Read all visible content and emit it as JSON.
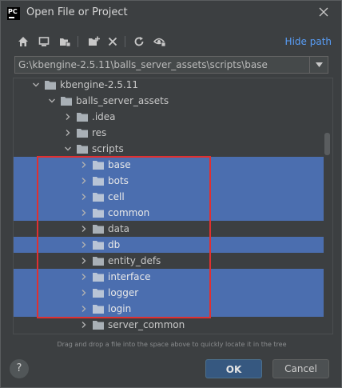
{
  "window": {
    "app_icon_text": "PC",
    "title": "Open File or Project",
    "close_icon": "close-icon"
  },
  "toolbar": {
    "buttons": [
      "home-icon",
      "desktop-icon",
      "project-folder-icon",
      "new-folder-icon",
      "delete-icon",
      "refresh-icon",
      "show-hidden-icon"
    ],
    "hide_path_label": "Hide path"
  },
  "path": {
    "value": "G:\\kbengine-2.5.11\\balls_server_assets\\scripts\\base"
  },
  "tree": {
    "items": [
      {
        "label": "kbengine-2.5.11",
        "depth": 1,
        "expanded": true,
        "selected": false
      },
      {
        "label": "balls_server_assets",
        "depth": 2,
        "expanded": true,
        "selected": false
      },
      {
        "label": ".idea",
        "depth": 3,
        "expanded": false,
        "selected": false
      },
      {
        "label": "res",
        "depth": 3,
        "expanded": false,
        "selected": false
      },
      {
        "label": "scripts",
        "depth": 3,
        "expanded": true,
        "selected": false
      },
      {
        "label": "base",
        "depth": 4,
        "expanded": false,
        "selected": true
      },
      {
        "label": "bots",
        "depth": 4,
        "expanded": false,
        "selected": true
      },
      {
        "label": "cell",
        "depth": 4,
        "expanded": false,
        "selected": true
      },
      {
        "label": "common",
        "depth": 4,
        "expanded": false,
        "selected": true
      },
      {
        "label": "data",
        "depth": 4,
        "expanded": false,
        "selected": false
      },
      {
        "label": "db",
        "depth": 4,
        "expanded": false,
        "selected": true
      },
      {
        "label": "entity_defs",
        "depth": 4,
        "expanded": false,
        "selected": false
      },
      {
        "label": "interface",
        "depth": 4,
        "expanded": false,
        "selected": true
      },
      {
        "label": "logger",
        "depth": 4,
        "expanded": false,
        "selected": true
      },
      {
        "label": "login",
        "depth": 4,
        "expanded": false,
        "selected": true
      },
      {
        "label": "server_common",
        "depth": 4,
        "expanded": false,
        "selected": false
      }
    ]
  },
  "hint": "Drag and drop a file into the space above to quickly locate it in the tree",
  "footer": {
    "help_label": "?",
    "ok_label": "OK",
    "cancel_label": "Cancel"
  },
  "colors": {
    "background": "#3c3f41",
    "selection": "#4b6eaf",
    "accent_link": "#589df6",
    "ok_button": "#365880",
    "annotation_box": "#e03030"
  }
}
